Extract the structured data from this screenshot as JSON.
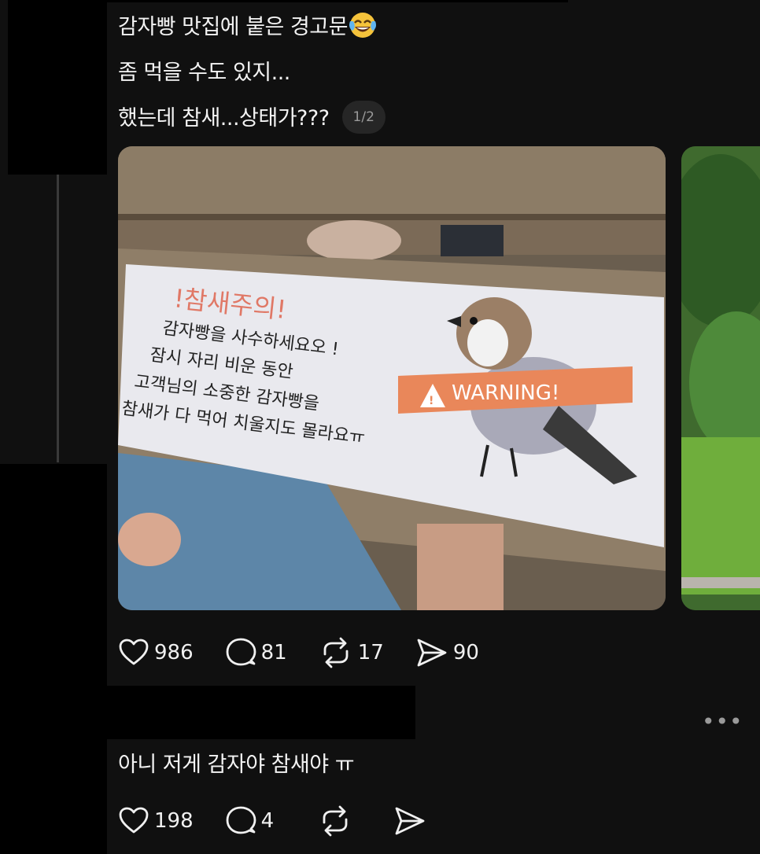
{
  "post": {
    "lines": [
      "감자빵 맛집에 붙은 경고문",
      "좀 먹을 수도 있지...",
      "했는데 참새...상태가???"
    ],
    "emoji": "face-with-tears-of-joy",
    "pager": "1/2"
  },
  "sign": {
    "title": "!참새주의!",
    "lines": [
      "감자빵을 사수하세요오 !",
      "잠시 자리 비운 동안",
      "고객님의 소중한 감자빵을",
      "참새가 다 먹어 치울지도 몰라요ㅠ"
    ],
    "warning": "WARNING!"
  },
  "post_actions": {
    "likes": "986",
    "comments": "81",
    "reposts": "17",
    "shares": "90"
  },
  "reply": {
    "text": "아니 저게 감자야 참새야 ㅠ",
    "more": "•••",
    "likes": "198",
    "comments": "4"
  },
  "colors": {
    "background": "#101010",
    "text": "#f3f3f3",
    "muted": "#9a9a9a",
    "warning_banner": "#e9875a"
  }
}
